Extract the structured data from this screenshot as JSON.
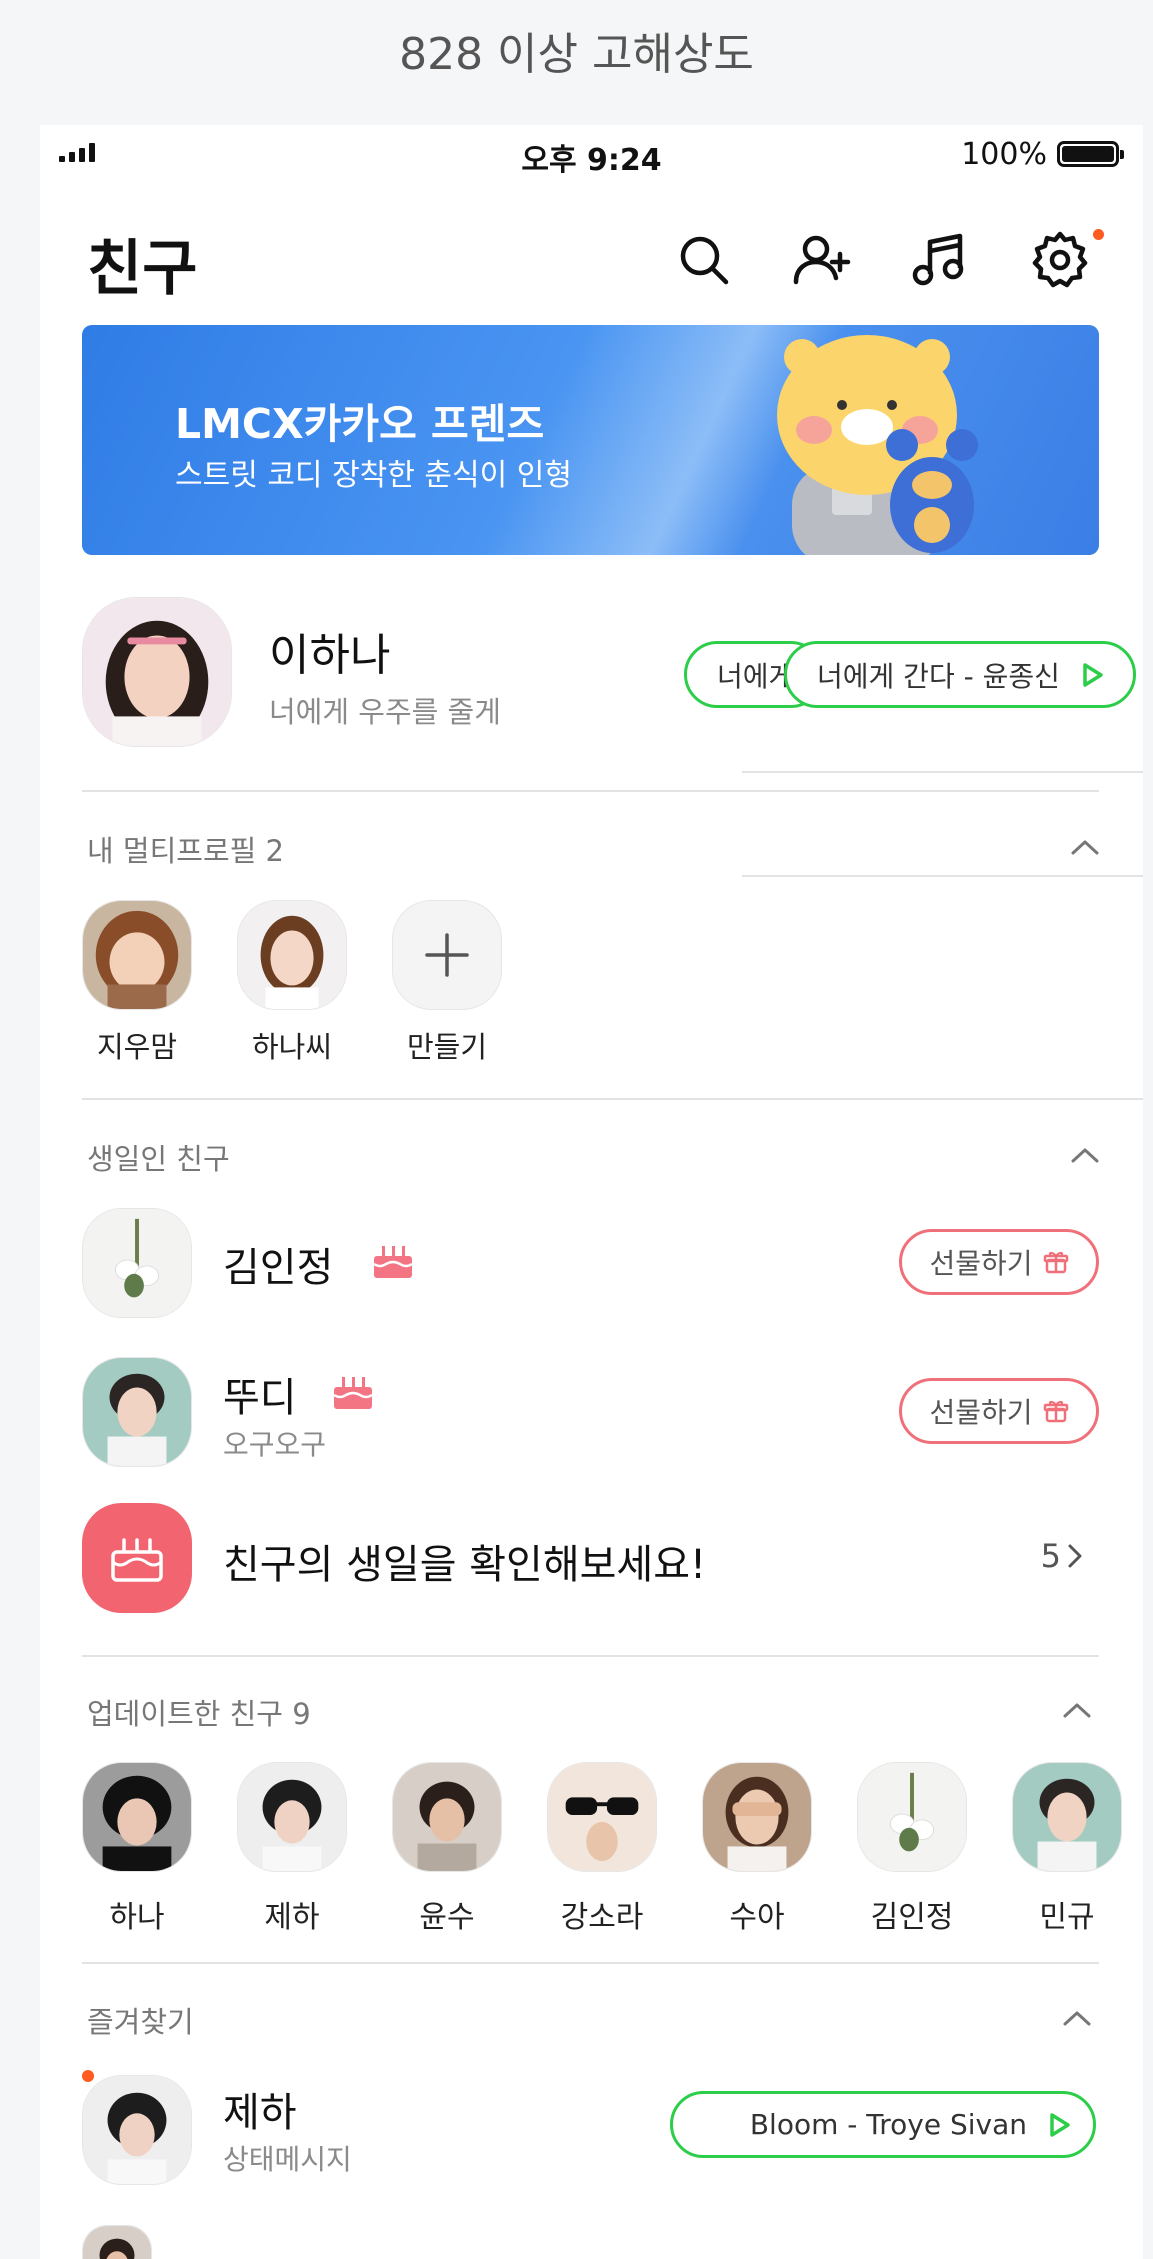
{
  "caption": "828 이상 고해상도",
  "status_bar": {
    "time": "오후 9:24",
    "battery": "100%"
  },
  "header": {
    "title": "친구"
  },
  "banner": {
    "title": "LMCX카카오 프렌즈",
    "subtitle": "스트릿 코디 장착한 춘식이 인형"
  },
  "profile": {
    "name": "이하나",
    "status": "너에게 우주를 줄게",
    "music_partial": "너에게",
    "music": "너에게 간다 - 윤종신"
  },
  "multi_profile": {
    "title": "내 멀티프로필 2",
    "items": [
      {
        "label": "지우맘"
      },
      {
        "label": "하나씨"
      },
      {
        "label": "만들기"
      }
    ]
  },
  "birthday": {
    "title": "생일인 친구",
    "friends": [
      {
        "name": "김인정",
        "sub": "",
        "button": "선물하기"
      },
      {
        "name": "뚜디",
        "sub": "오구오구",
        "button": "선물하기"
      }
    ],
    "check_text": "친구의 생일을 확인해보세요!",
    "count": "5"
  },
  "updated": {
    "title": "업데이트한 친구 9",
    "friends": [
      {
        "name": "하나"
      },
      {
        "name": "제하"
      },
      {
        "name": "윤수"
      },
      {
        "name": "강소라"
      },
      {
        "name": "수아"
      },
      {
        "name": "김인정"
      },
      {
        "name": "민규"
      }
    ]
  },
  "favorites": {
    "title": "즐겨찾기",
    "items": [
      {
        "name": "제하",
        "status": "상태메시지",
        "music": "Bloom - Troye Sivan"
      }
    ]
  },
  "colors": {
    "accent_green": "#2ccd49",
    "gift_pink": "#f0707a",
    "birthday_red": "#f16470",
    "banner_blue": "#3b84ea",
    "badge_orange": "#ff5a1f"
  }
}
